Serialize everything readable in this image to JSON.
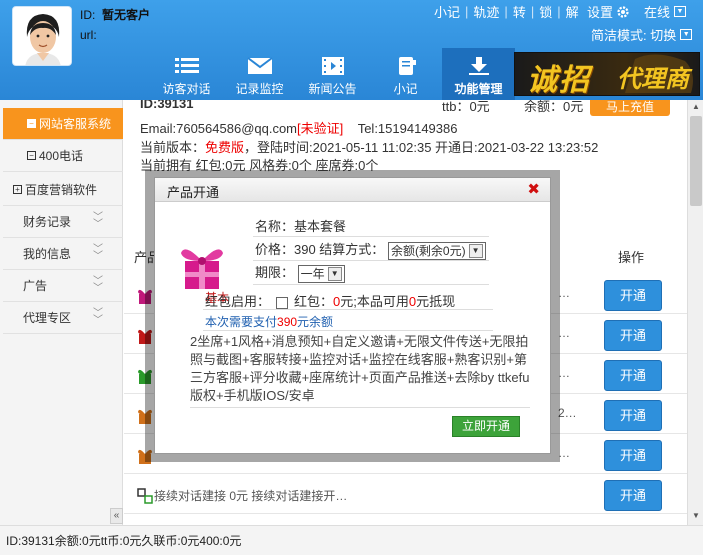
{
  "user": {
    "id_label": "ID:",
    "name": "暂无客户",
    "url_label": "url:"
  },
  "toplinks": [
    "小记",
    "轨迹",
    "转",
    "锁",
    "解"
  ],
  "settings_label": "设置",
  "online_label": "在线",
  "mode_label": "简洁模式: 切换",
  "nav": [
    {
      "label": "访客对话",
      "icon": "list-icon"
    },
    {
      "label": "记录监控",
      "icon": "mail-icon"
    },
    {
      "label": "新闻公告",
      "icon": "film-icon"
    },
    {
      "label": "小记",
      "icon": "note-icon"
    },
    {
      "label": "功能管理",
      "icon": "download-icon"
    }
  ],
  "banner_text": "诚招",
  "sidebar": [
    {
      "label": "网站客服系统",
      "active": true,
      "mark": "−"
    },
    {
      "label": "400电话",
      "active": false,
      "mark": "−"
    },
    {
      "label": "百度营销软件",
      "active": false,
      "mark": "+"
    },
    {
      "label": "财务记录",
      "active": false
    },
    {
      "label": "我的信息",
      "active": false
    },
    {
      "label": "广告",
      "active": false
    },
    {
      "label": "代理专区",
      "active": false
    }
  ],
  "collapse_symbol": "«",
  "main": {
    "id_line": "ID:39131",
    "tt_line": "ttb：0元",
    "balance_line": "余额：0元",
    "top_button": "马上充值",
    "email_prefix": "Email:760564586@qq.com",
    "email_status": "[未验证]",
    "tel": "Tel:15194149386",
    "version_prefix": "当前版本：",
    "version_value": "免费版",
    "version_suffix": "，登陆时间:2021-05-11 11:02:35 开通日:2021-03-22 13:23:52",
    "owned_line": "当前拥有 红包:0元  风格券:0个  座席券:0个",
    "col_product": "产品",
    "col_op": "操作",
    "rows": [
      {
        "text": "…",
        "btn": "开通",
        "color": "#c0187a"
      },
      {
        "text": "…",
        "btn": "开通",
        "color": "#c01818"
      },
      {
        "text": "…",
        "btn": "开通",
        "color": "#2a9a2a"
      },
      {
        "text": "2…",
        "btn": "开通",
        "color": "#d0701a"
      },
      {
        "text": "…",
        "btn": "开通",
        "color": "#d0701a"
      },
      {
        "text": "跨…",
        "btn": "开通",
        "color": "#2a9a2a"
      }
    ],
    "bottom_row_text": "接续对话建接     0元     接续对话建接开…"
  },
  "dialog": {
    "title": "产品开通",
    "close": "✖",
    "gift_label": "基本",
    "name_line": "名称：基本套餐",
    "price_line": "价格：390  结算方式：",
    "pay_select": "余额(剩余0元)",
    "period_label": "期限：",
    "period_select": "一年",
    "redpack_label": "红包启用：",
    "redpack_text_a": "红包：",
    "redpack_amount": "0",
    "redpack_text_b": "元;本品可用",
    "redpack_usable": "0",
    "redpack_text_c": "元抵现",
    "pay_needed_a": "本次需要支付",
    "pay_needed_amount": "390",
    "pay_needed_b": "元余额",
    "description": "2坐席+1风格+消息预知+自定义邀请+无限文件传送+无限拍照与截图+客服转接+监控对话+监控在线客服+熟客识别+第三方客服+评分收藏+座席统计+页面产品推送+去除by ttkefu版权+手机版IOS/安卓",
    "confirm": "立即开通"
  },
  "statusbar": "ID:39131余额:0元tt币:0元久联币:0元400:0元",
  "colors": {
    "header": "#2f8edf",
    "accent": "#f8941d",
    "button": "#2e90dc",
    "confirm": "#3da33a",
    "red": "#e00000"
  }
}
